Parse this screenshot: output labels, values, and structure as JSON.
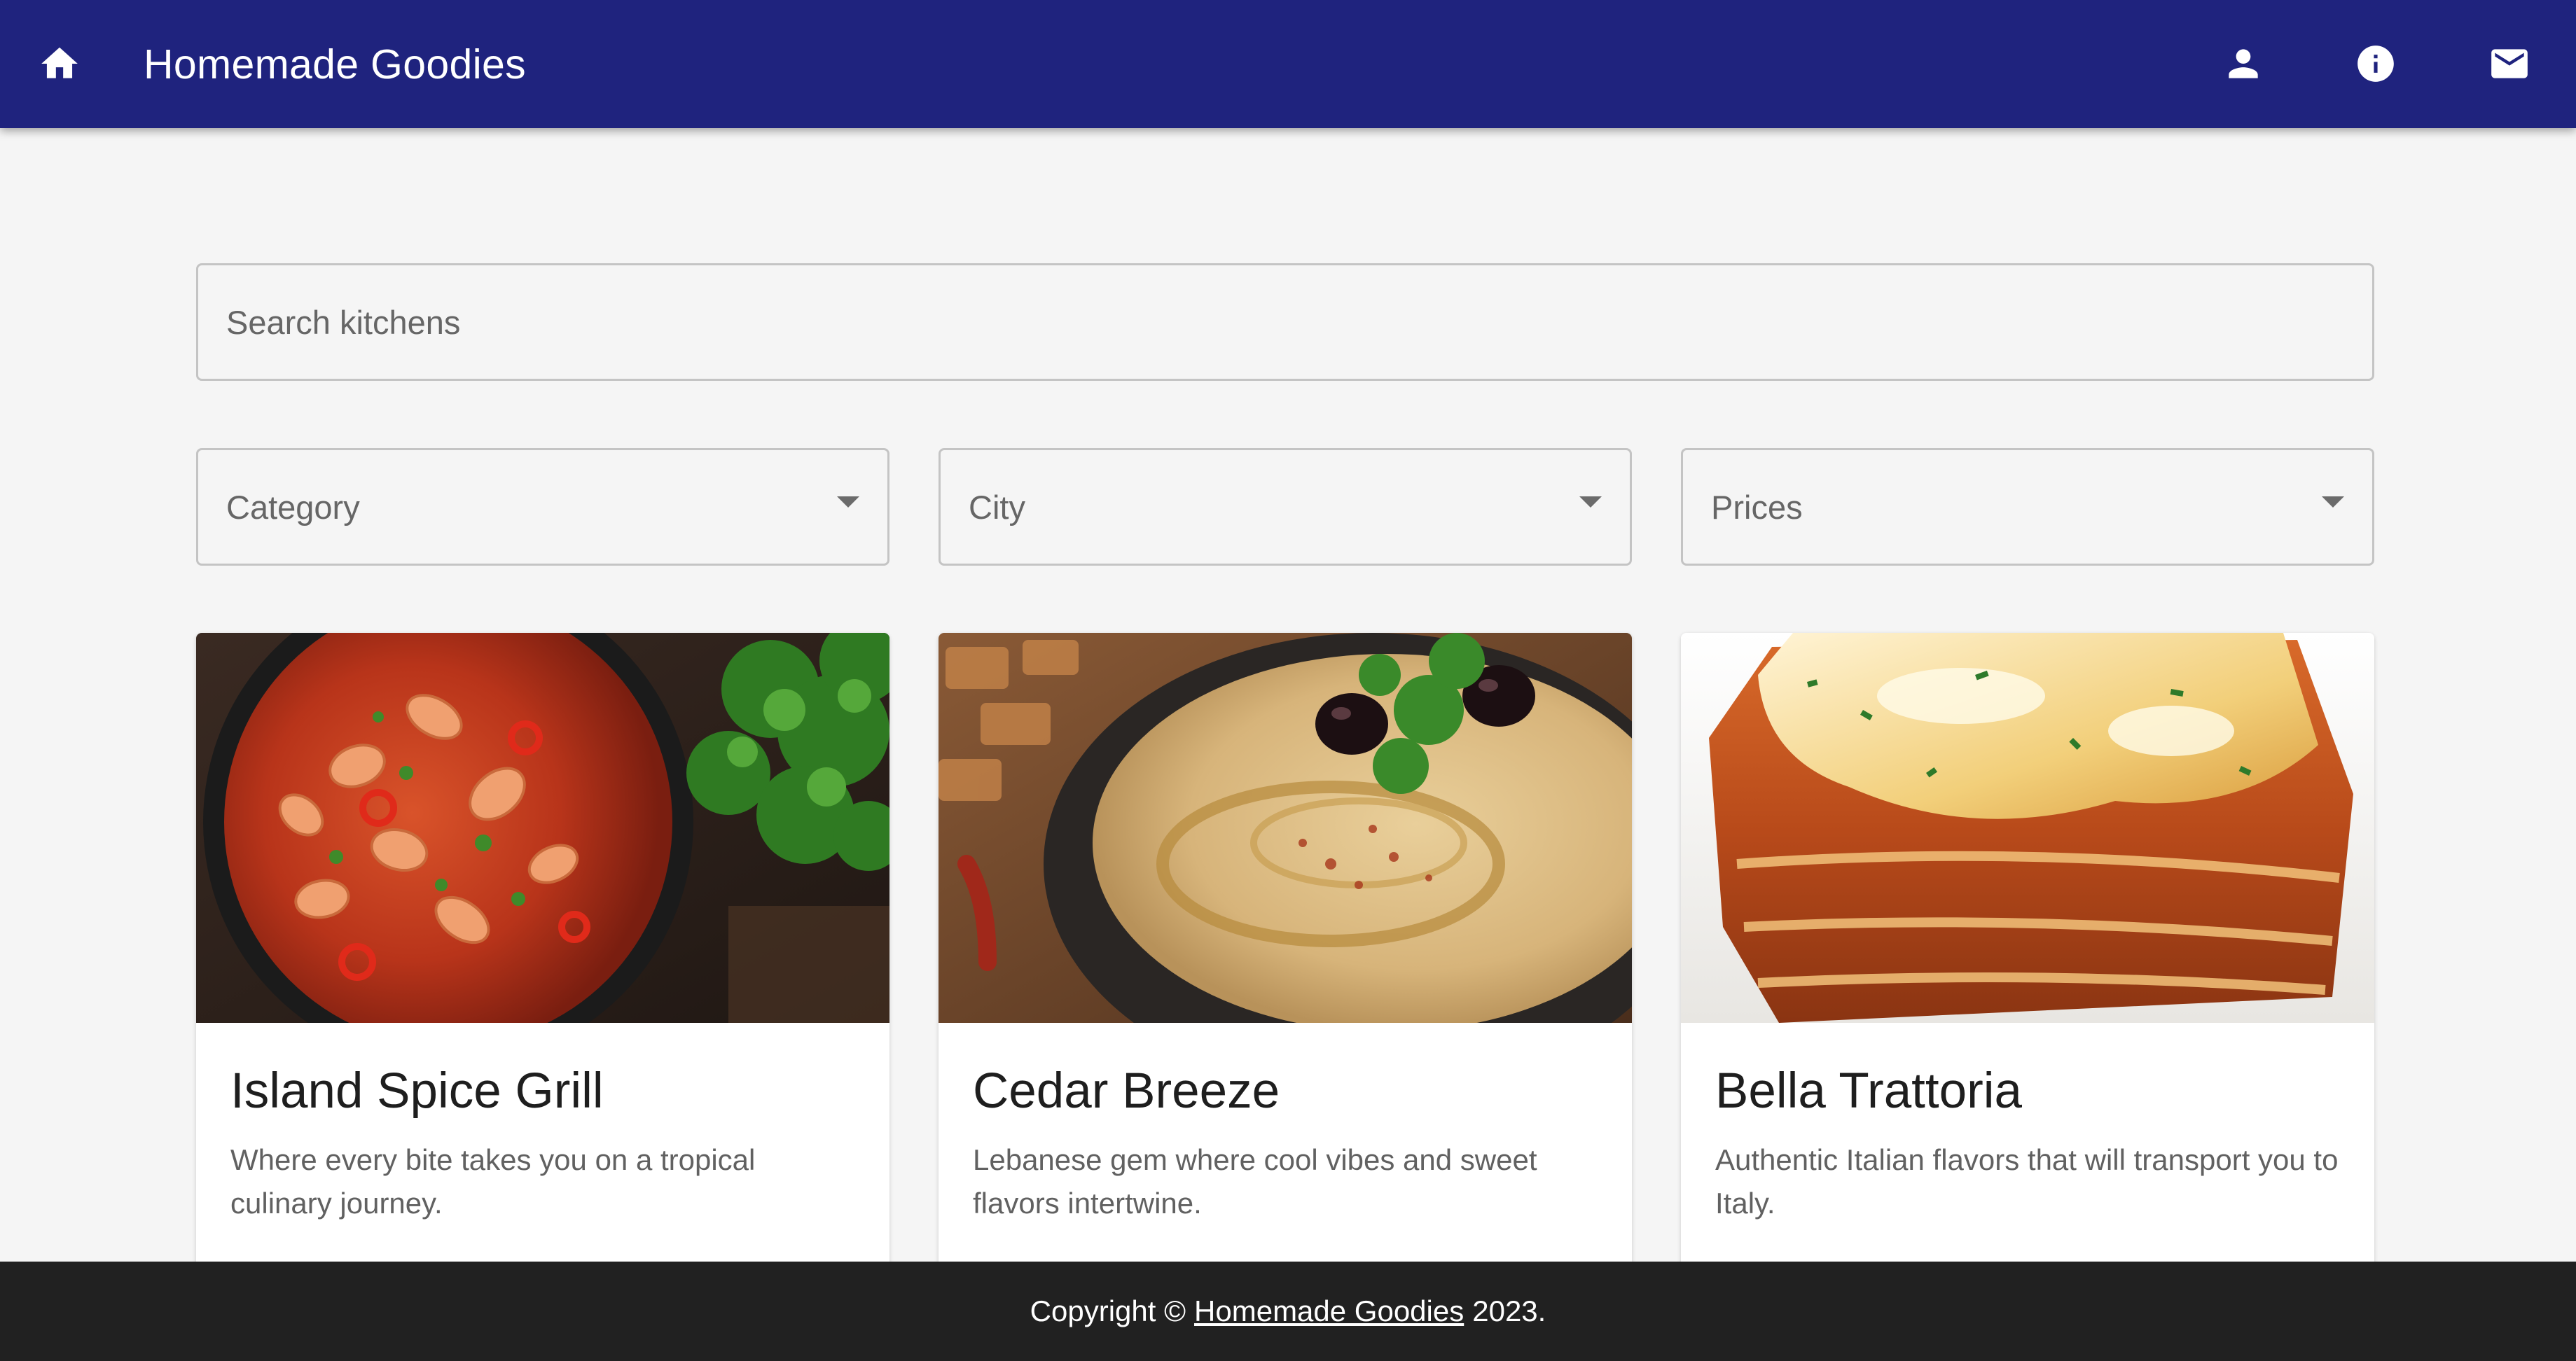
{
  "app": {
    "title": "Homemade Goodies",
    "colors": {
      "appbar": "#1f237e",
      "background": "#f5f5f5",
      "footer": "#212121",
      "card": "#ffffff"
    },
    "icons": {
      "home": "home-icon",
      "user": "account-icon",
      "info": "info-icon",
      "mail": "mail-icon"
    }
  },
  "search": {
    "placeholder": "Search kitchens",
    "value": ""
  },
  "filters": {
    "category": {
      "label": "Category"
    },
    "city": {
      "label": "City"
    },
    "prices": {
      "label": "Prices"
    }
  },
  "kitchens": [
    {
      "name": "Island Spice Grill",
      "description": "Where every bite takes you on a tropical culinary journey."
    },
    {
      "name": "Cedar Breeze",
      "description": "Lebanese gem where cool vibes and sweet flavors intertwine."
    },
    {
      "name": "Bella Trattoria",
      "description": "Authentic Italian flavors that will transport you to Italy."
    }
  ],
  "footer": {
    "prefix": "Copyright ©",
    "link_text": "Homemade Goodies",
    "suffix": "2023."
  }
}
